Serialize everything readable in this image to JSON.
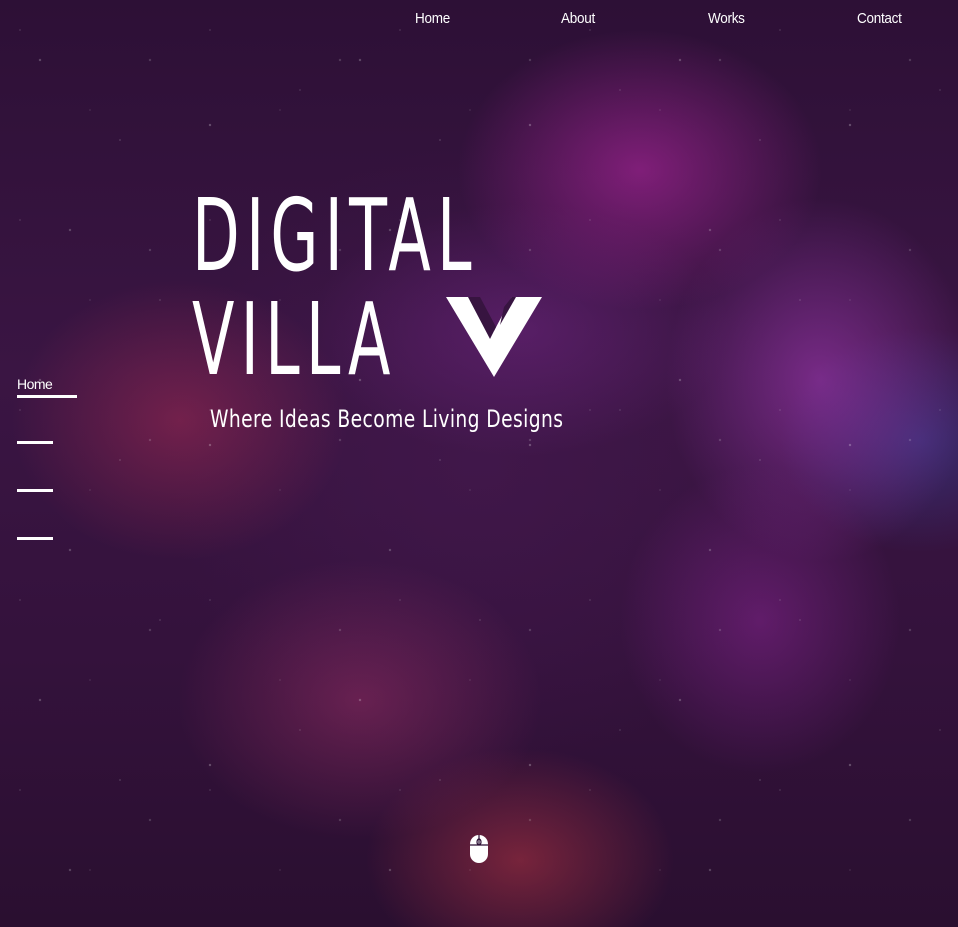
{
  "nav": {
    "home": "Home",
    "about": "About",
    "works": "Works",
    "contact": "Contact"
  },
  "side_nav": {
    "active_label": "Home"
  },
  "hero": {
    "title_line1": "DIGITAL",
    "title_line2": "VILLA",
    "tagline": "Where Ideas Become Living Designs"
  },
  "icons": {
    "logo": "villa-v-logo-icon",
    "scroll": "mouse-scroll-icon"
  },
  "colors": {
    "background": "#2b0f33",
    "text": "#ffffff"
  }
}
